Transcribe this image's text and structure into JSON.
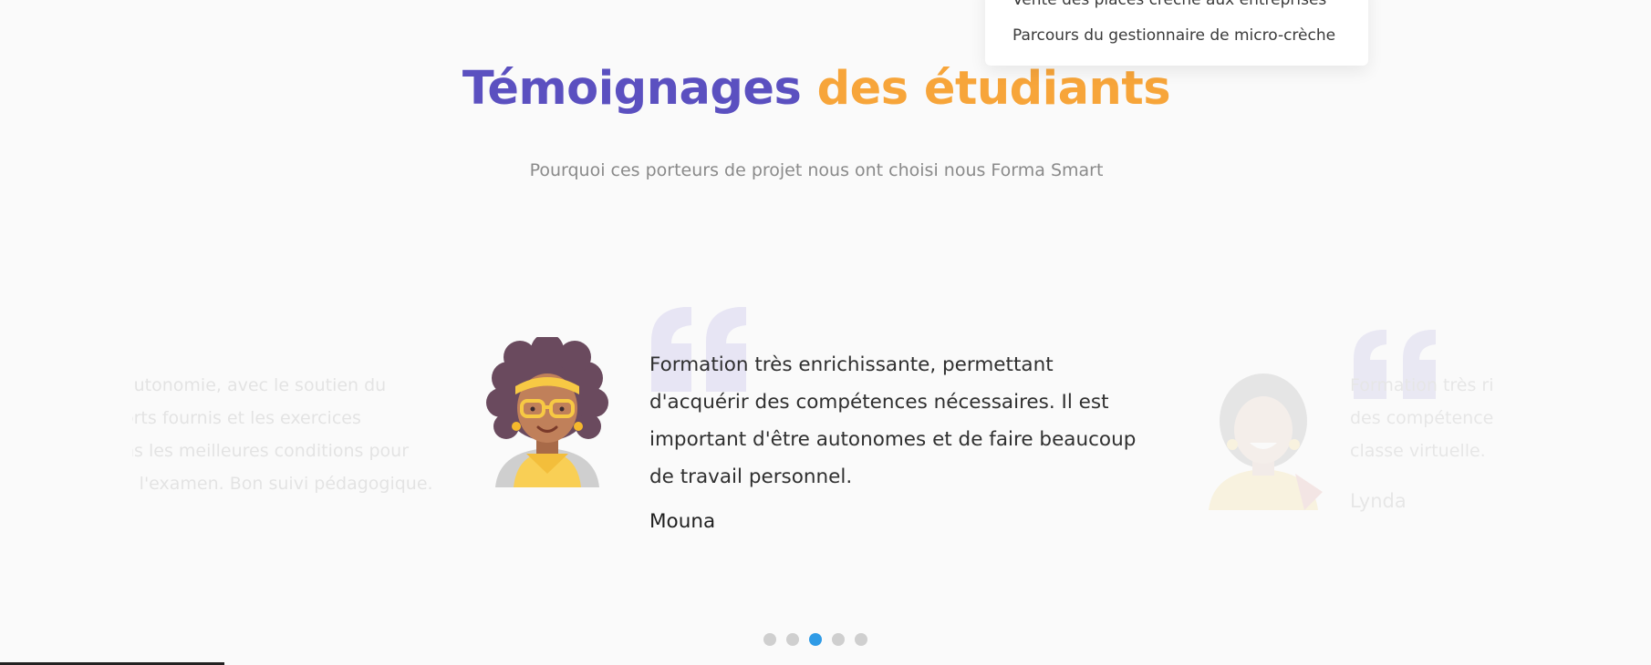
{
  "dropdown": {
    "items": [
      {
        "label": "Vente des places crèche aux entreprises"
      },
      {
        "label": "Parcours du gestionnaire de micro-crèche"
      }
    ]
  },
  "section": {
    "title_part1": "Témoignages",
    "title_part2": "des étudiants",
    "subtitle": "Pourquoi ces porteurs de projet nous ont choisi nous Forma Smart"
  },
  "testimonials": {
    "previous": {
      "lines": [
        "autonomie, avec le soutien du",
        "orts fournis et les exercices",
        "ns les meilleures conditions pour",
        "à l'examen. Bon suivi pédagogique."
      ]
    },
    "current": {
      "lines": [
        "Formation très enrichissante, permettant",
        "d'acquérir des compétences nécessaires. Il est",
        "important d'être autonomes et de faire beaucoup",
        "de travail personnel."
      ],
      "author": "Mouna"
    },
    "next": {
      "lines": [
        "Formation très ri",
        "des compétence",
        "classe virtuelle."
      ],
      "author": "Lynda"
    }
  },
  "pagination": {
    "total": 5,
    "active_index": 2
  },
  "colors": {
    "title_primary": "#5b50c0",
    "title_accent": "#f7a53a",
    "dot_active": "#2f9be6",
    "dot_inactive": "#cfcfcf"
  }
}
